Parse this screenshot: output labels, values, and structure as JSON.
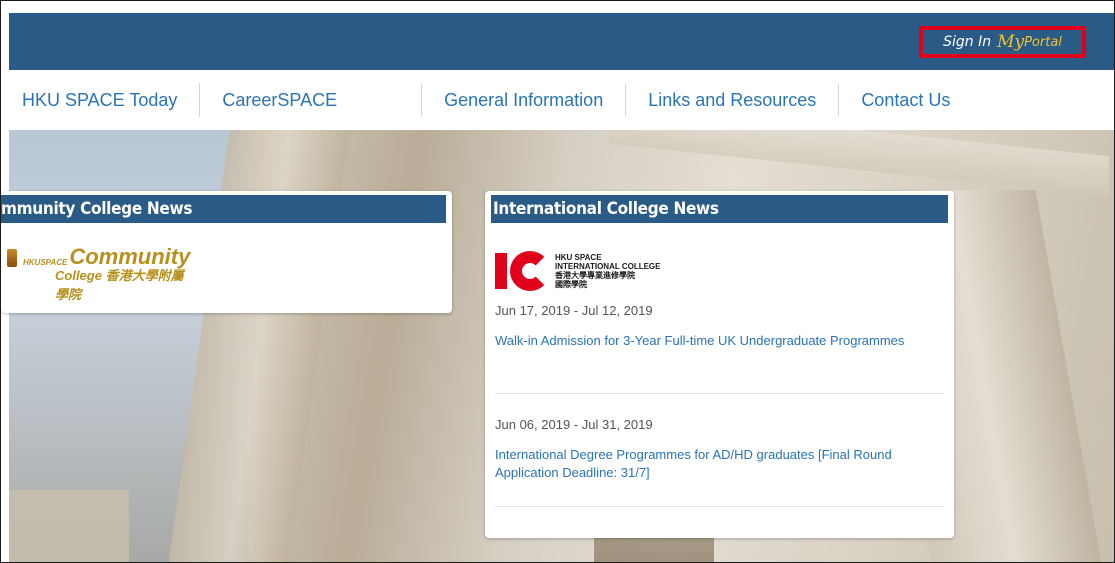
{
  "header": {
    "signin_label": "Sign In",
    "myportal_my": "My",
    "myportal_portal": "Portal"
  },
  "nav": {
    "items": [
      {
        "label": "HKU SPACE Today"
      },
      {
        "label": "CareerSPACE"
      },
      {
        "label": "General Information"
      },
      {
        "label": "Links and Resources"
      },
      {
        "label": "Contact Us"
      }
    ]
  },
  "community_card": {
    "title": "mmunity College News",
    "logo_prefix": "HKUSPACE",
    "logo_main": "Community",
    "logo_sub": "College 香港大學附屬學院"
  },
  "international_card": {
    "title": "International College News",
    "logo_lines": [
      "HKU SPACE",
      "INTERNATIONAL COLLEGE",
      "香港大學專業進修學院",
      "國際學院"
    ],
    "items": [
      {
        "date": "Jun 17, 2019 - Jul 12, 2019",
        "title": "Walk-in Admission for 3-Year Full-time UK Undergraduate Programmes"
      },
      {
        "date": "Jun 06, 2019 - Jul 31, 2019",
        "title": "International Degree Programmes for AD/HD graduates [Final Round Application Deadline: 31/7]"
      }
    ]
  },
  "colors": {
    "header_blue": "#2a5a86",
    "link_blue": "#2a74b5",
    "highlight_red": "#e0001b",
    "portal_gold": "#f2c12e"
  }
}
